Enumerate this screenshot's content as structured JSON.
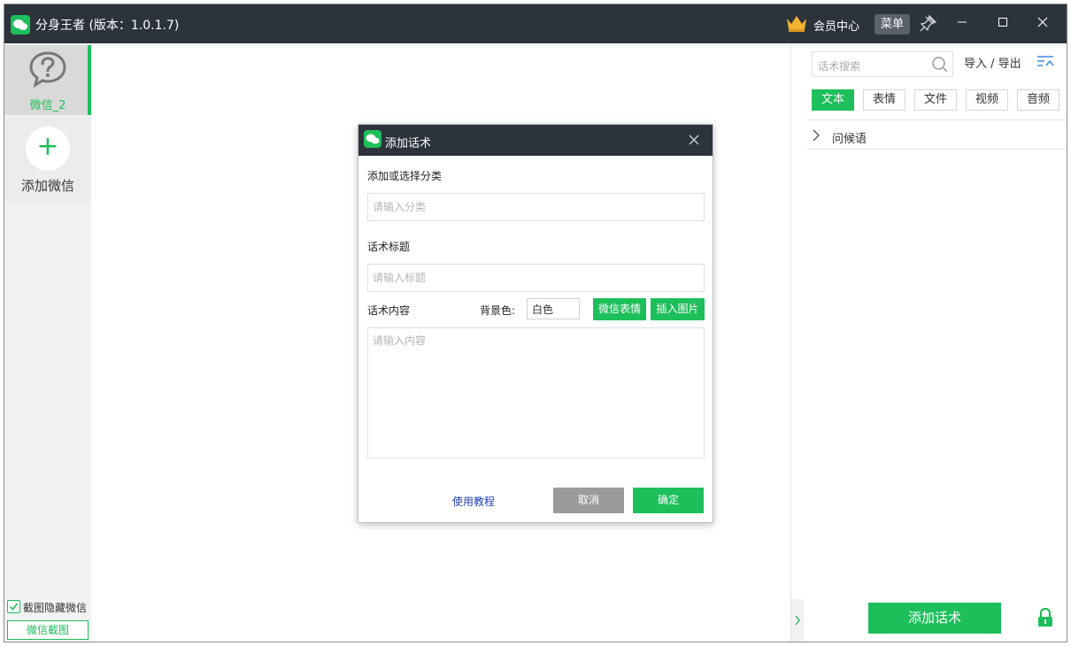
{
  "app": {
    "title": "分身王者 (版本：1.0.1.7)",
    "member_center": "会员中心",
    "menu_label": "菜单",
    "accent_color": "#1dbf5a",
    "titlebar_color": "#2d333b"
  },
  "sidebar": {
    "account_label": "微信_2",
    "add_account_label": "添加微信",
    "hide_screenshot_label": "截图隐藏微信",
    "hide_screenshot_checked": true,
    "screenshot_button": "微信截图"
  },
  "right_panel": {
    "search_placeholder": "话术搜索",
    "import_export": "导入 / 导出",
    "tabs": [
      {
        "label": "文本",
        "active": true
      },
      {
        "label": "表情",
        "active": false
      },
      {
        "label": "文件",
        "active": false
      },
      {
        "label": "视频",
        "active": false
      },
      {
        "label": "音频",
        "active": false
      }
    ],
    "group_label": "问候语",
    "add_script_button": "添加话术"
  },
  "dialog": {
    "title": "添加话术",
    "category_label": "添加或选择分类",
    "category_placeholder": "请输入分类",
    "title_label": "话术标题",
    "title_placeholder": "请输入标题",
    "content_label": "话术内容",
    "bg_color_label": "背景色:",
    "bg_color_value": "白色",
    "wechat_emoji_button": "微信表情",
    "insert_image_button": "插入图片",
    "content_placeholder": "请输入内容",
    "tutorial_link": "使用教程",
    "cancel_button": "取消",
    "ok_button": "确定"
  }
}
